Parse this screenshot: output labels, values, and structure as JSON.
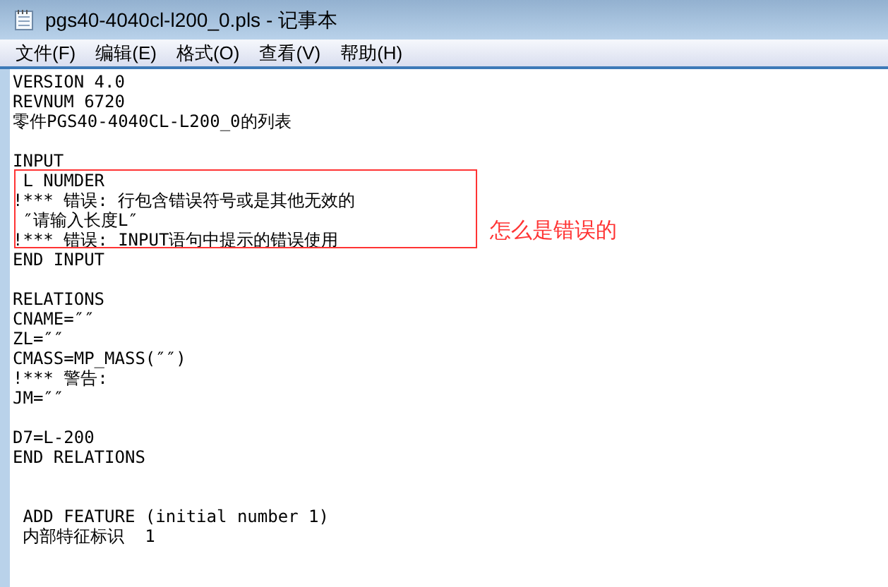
{
  "window": {
    "title": "pgs40-4040cl-l200_0.pls - 记事本"
  },
  "menu": [
    {
      "label": "文件(F)"
    },
    {
      "label": "编辑(E)"
    },
    {
      "label": "格式(O)"
    },
    {
      "label": "查看(V)"
    },
    {
      "label": "帮助(H)"
    }
  ],
  "lines": [
    {
      "kind": "text",
      "text": "VERSION 4.0"
    },
    {
      "kind": "text",
      "text": "REVNUM 6720"
    },
    {
      "kind": "text",
      "text": "零件PGS40-4040CL-L200_0的列表"
    },
    {
      "kind": "blank"
    },
    {
      "kind": "text",
      "text": "INPUT"
    },
    {
      "kind": "text",
      "text": " L NUMDER"
    },
    {
      "kind": "text",
      "text": "!*** 错误: 行包含错误符号或是其他无效的"
    },
    {
      "kind": "text",
      "text": " ″请输入长度L″"
    },
    {
      "kind": "text",
      "text": "!*** 错误: INPUT语句中提示的错误使用"
    },
    {
      "kind": "text",
      "text": "END INPUT"
    },
    {
      "kind": "blank"
    },
    {
      "kind": "text",
      "text": "RELATIONS"
    },
    {
      "kind": "text",
      "text": "CNAME=″″"
    },
    {
      "kind": "text",
      "text": "ZL=″″"
    },
    {
      "kind": "text",
      "text": "CMASS=MP_MASS(″″)"
    },
    {
      "kind": "text",
      "text": "!*** 警告:"
    },
    {
      "kind": "text",
      "text": "JM=″″"
    },
    {
      "kind": "blank"
    },
    {
      "kind": "text",
      "text": "D7=L-200"
    },
    {
      "kind": "text",
      "text": "END RELATIONS"
    },
    {
      "kind": "blank"
    },
    {
      "kind": "blank"
    },
    {
      "kind": "text",
      "text": " ADD FEATURE (initial number 1)"
    },
    {
      "kind": "text",
      "text": " 内部特征标识  1"
    }
  ],
  "annotation": {
    "text": "怎么是错误的"
  }
}
